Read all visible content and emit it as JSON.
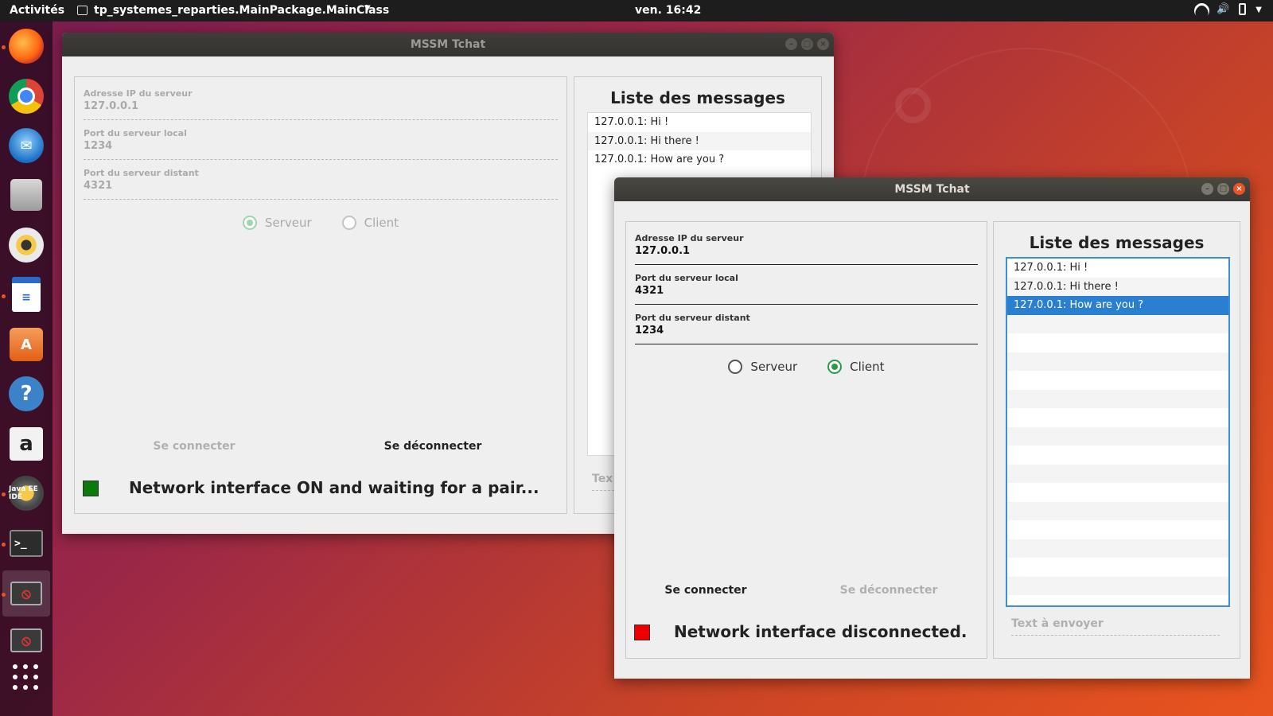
{
  "topbar": {
    "activities": "Activités",
    "app_name": "tp_systemes_reparties.MainPackage.MainClass",
    "clock": "ven. 16:42"
  },
  "dock": {
    "items": [
      "firefox-icon",
      "chrome-icon",
      "thunderbird-icon",
      "files-icon",
      "rhythmbox-icon",
      "libreoffice-writer-icon",
      "ubuntu-software-icon",
      "help-icon",
      "amazon-icon",
      "java-ee-ide-icon",
      "terminal-icon",
      "java-app-icon",
      "java-app-icon",
      "show-applications-icon"
    ],
    "java_label": "Java EE IDE"
  },
  "window_back": {
    "title": "MSSM Tchat",
    "fields": [
      {
        "label": "Adresse IP du serveur",
        "value": "127.0.0.1"
      },
      {
        "label": "Port du serveur local",
        "value": "1234"
      },
      {
        "label": "Port du serveur distant",
        "value": "4321"
      }
    ],
    "radio_server": "Serveur",
    "radio_client": "Client",
    "selected_mode": "Serveur",
    "connect_label": "Se connecter",
    "disconnect_label": "Se déconnecter",
    "status_text": "Network interface ON and waiting for a pair...",
    "status_color": "#0a7a0a",
    "list_title": "Liste des messages",
    "messages": [
      "127.0.0.1: Hi !",
      "127.0.0.1: Hi there !",
      "127.0.0.1: How are you ?"
    ],
    "send_placeholder": "Tex"
  },
  "window_front": {
    "title": "MSSM Tchat",
    "fields": [
      {
        "label": "Adresse IP du serveur",
        "value": "127.0.0.1"
      },
      {
        "label": "Port du serveur local",
        "value": "4321"
      },
      {
        "label": "Port du serveur distant",
        "value": "1234"
      }
    ],
    "radio_server": "Serveur",
    "radio_client": "Client",
    "selected_mode": "Client",
    "connect_label": "Se connecter",
    "disconnect_label": "Se déconnecter",
    "status_text": "Network interface disconnected.",
    "status_color": "#ee0000",
    "list_title": "Liste des messages",
    "messages": [
      "127.0.0.1: Hi !",
      "127.0.0.1: Hi there !",
      "127.0.0.1: How are you ?"
    ],
    "selected_message": "127.0.0.1: How are you ?",
    "send_placeholder": "Text à envoyer"
  },
  "colors": {
    "accent": "#e95420",
    "selection": "#2b7fd1",
    "radio_selected": "#2a9b4a"
  }
}
